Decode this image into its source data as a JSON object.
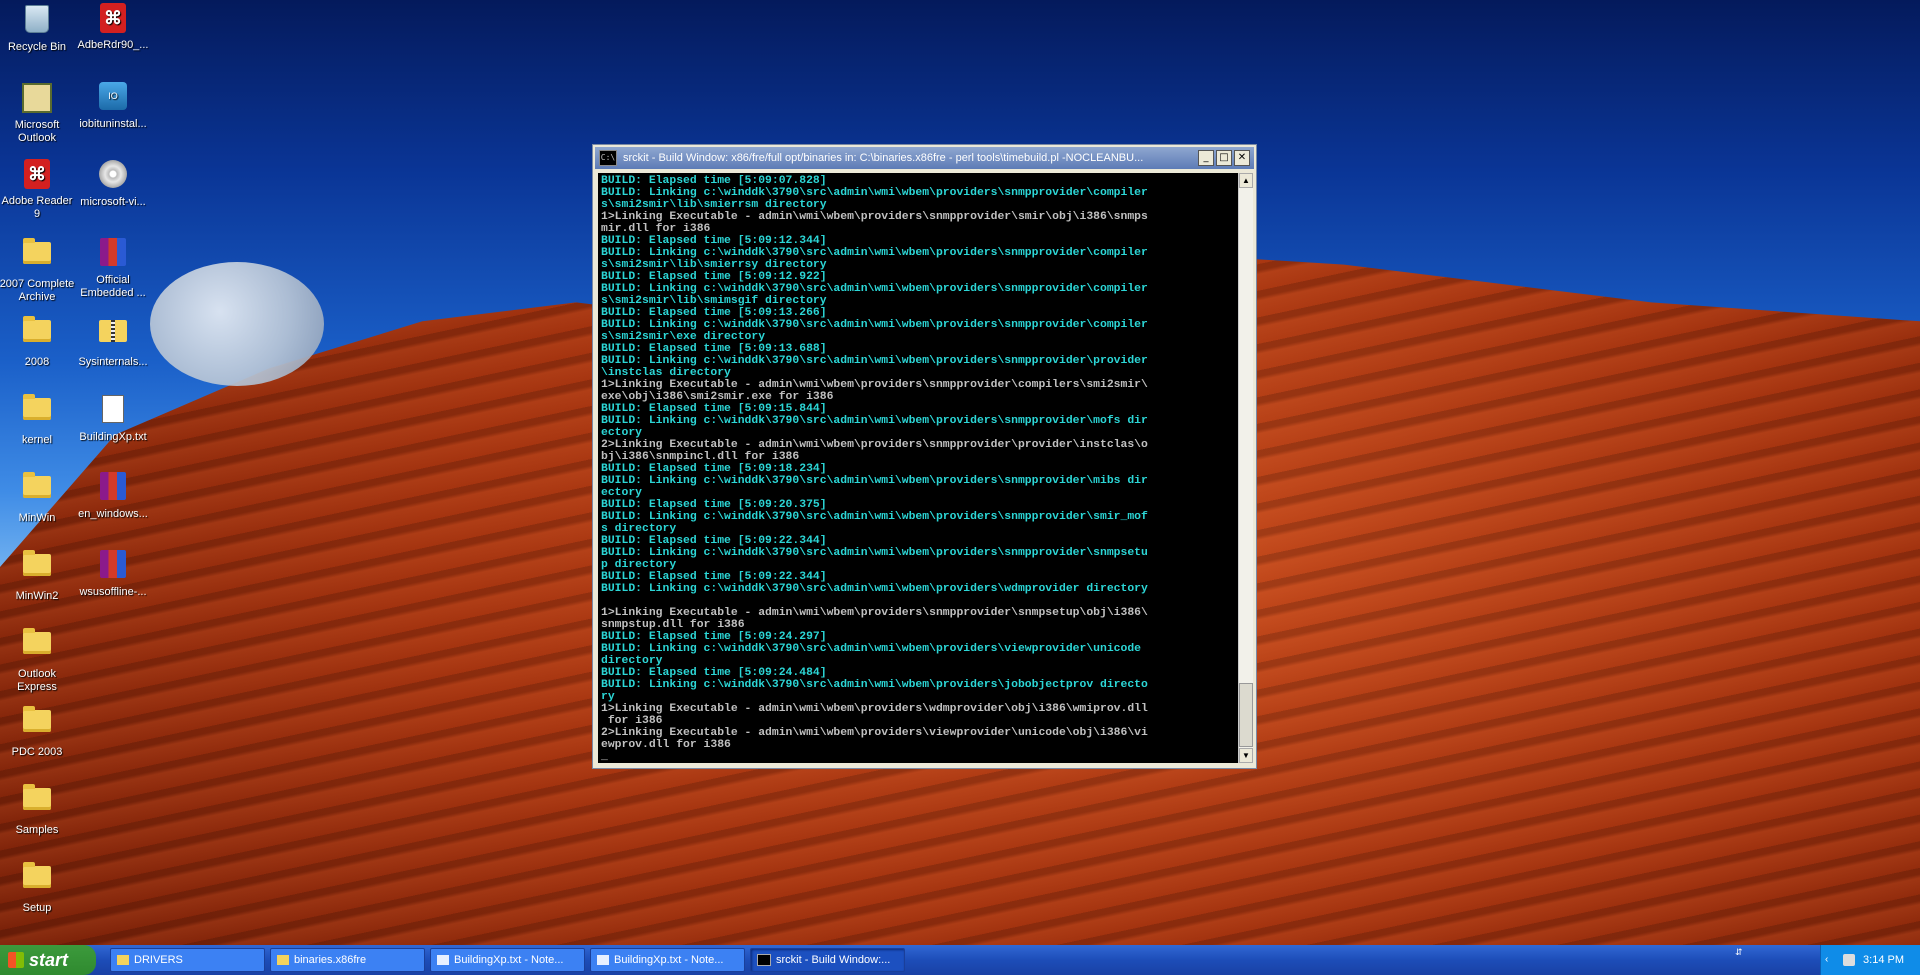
{
  "desktop": {
    "icons": [
      {
        "label": "Recycle Bin",
        "icon": "recycle-bin-icon"
      },
      {
        "label": "AdbeRdr90_...",
        "icon": "pdf-icon"
      },
      {
        "label": "Microsoft Outlook",
        "icon": "outlook-icon"
      },
      {
        "label": "iobituninstal...",
        "icon": "installer-icon"
      },
      {
        "label": "Adobe Reader 9",
        "icon": "pdf-icon"
      },
      {
        "label": "microsoft-vi...",
        "icon": "disc-icon"
      },
      {
        "label": "2007 Complete Archive",
        "icon": "folder-icon"
      },
      {
        "label": "Official Embedded ...",
        "icon": "winrar-icon"
      },
      {
        "label": "2008",
        "icon": "folder-icon"
      },
      {
        "label": "Sysinternals...",
        "icon": "zip-folder-icon"
      },
      {
        "label": "kernel",
        "icon": "folder-icon"
      },
      {
        "label": "BuildingXp.txt",
        "icon": "text-file-icon"
      },
      {
        "label": "MinWin",
        "icon": "folder-icon"
      },
      {
        "label": "en_windows...",
        "icon": "winrar-icon"
      },
      {
        "label": "MinWin2",
        "icon": "folder-icon"
      },
      {
        "label": "wsusoffline-...",
        "icon": "winrar-icon"
      },
      {
        "label": "Outlook Express",
        "icon": "folder-icon"
      },
      {
        "label": "PDC 2003",
        "icon": "folder-icon"
      },
      {
        "label": "Samples",
        "icon": "folder-icon"
      },
      {
        "label": "Setup",
        "icon": "folder-icon"
      }
    ]
  },
  "window": {
    "title": "srckit - Build Window: x86/fre/full opt/binaries in: C:\\binaries.x86fre - perl tools\\timebuild.pl -NOCLEANBU...",
    "minimize": "_",
    "maximize": "□",
    "close": "✕",
    "console_lines": [
      {
        "c": "cyan",
        "t": "BUILD: Elapsed time [5:09:07.828]"
      },
      {
        "c": "cyan",
        "t": "BUILD: Linking c:\\winddk\\3790\\src\\admin\\wmi\\wbem\\providers\\snmpprovider\\compiler"
      },
      {
        "c": "cyan",
        "t": "s\\smi2smir\\lib\\smierrsm directory"
      },
      {
        "c": "grey",
        "t": "1>Linking Executable - admin\\wmi\\wbem\\providers\\snmpprovider\\smir\\obj\\i386\\snmps"
      },
      {
        "c": "grey",
        "t": "mir.dll for i386"
      },
      {
        "c": "cyan",
        "t": "BUILD: Elapsed time [5:09:12.344]"
      },
      {
        "c": "cyan",
        "t": "BUILD: Linking c:\\winddk\\3790\\src\\admin\\wmi\\wbem\\providers\\snmpprovider\\compiler"
      },
      {
        "c": "cyan",
        "t": "s\\smi2smir\\lib\\smierrsy directory"
      },
      {
        "c": "cyan",
        "t": "BUILD: Elapsed time [5:09:12.922]"
      },
      {
        "c": "cyan",
        "t": "BUILD: Linking c:\\winddk\\3790\\src\\admin\\wmi\\wbem\\providers\\snmpprovider\\compiler"
      },
      {
        "c": "cyan",
        "t": "s\\smi2smir\\lib\\smimsgif directory"
      },
      {
        "c": "cyan",
        "t": "BUILD: Elapsed time [5:09:13.266]"
      },
      {
        "c": "cyan",
        "t": "BUILD: Linking c:\\winddk\\3790\\src\\admin\\wmi\\wbem\\providers\\snmpprovider\\compiler"
      },
      {
        "c": "cyan",
        "t": "s\\smi2smir\\exe directory"
      },
      {
        "c": "cyan",
        "t": "BUILD: Elapsed time [5:09:13.688]"
      },
      {
        "c": "cyan",
        "t": "BUILD: Linking c:\\winddk\\3790\\src\\admin\\wmi\\wbem\\providers\\snmpprovider\\provider"
      },
      {
        "c": "cyan",
        "t": "\\instclas directory"
      },
      {
        "c": "grey",
        "t": "1>Linking Executable - admin\\wmi\\wbem\\providers\\snmpprovider\\compilers\\smi2smir\\"
      },
      {
        "c": "grey",
        "t": "exe\\obj\\i386\\smi2smir.exe for i386"
      },
      {
        "c": "cyan",
        "t": "BUILD: Elapsed time [5:09:15.844]"
      },
      {
        "c": "cyan",
        "t": "BUILD: Linking c:\\winddk\\3790\\src\\admin\\wmi\\wbem\\providers\\snmpprovider\\mofs dir"
      },
      {
        "c": "cyan",
        "t": "ectory"
      },
      {
        "c": "grey",
        "t": "2>Linking Executable - admin\\wmi\\wbem\\providers\\snmpprovider\\provider\\instclas\\o"
      },
      {
        "c": "grey",
        "t": "bj\\i386\\snmpincl.dll for i386"
      },
      {
        "c": "cyan",
        "t": "BUILD: Elapsed time [5:09:18.234]"
      },
      {
        "c": "cyan",
        "t": "BUILD: Linking c:\\winddk\\3790\\src\\admin\\wmi\\wbem\\providers\\snmpprovider\\mibs dir"
      },
      {
        "c": "cyan",
        "t": "ectory"
      },
      {
        "c": "cyan",
        "t": "BUILD: Elapsed time [5:09:20.375]"
      },
      {
        "c": "cyan",
        "t": "BUILD: Linking c:\\winddk\\3790\\src\\admin\\wmi\\wbem\\providers\\snmpprovider\\smir_mof"
      },
      {
        "c": "cyan",
        "t": "s directory"
      },
      {
        "c": "cyan",
        "t": "BUILD: Elapsed time [5:09:22.344]"
      },
      {
        "c": "cyan",
        "t": "BUILD: Linking c:\\winddk\\3790\\src\\admin\\wmi\\wbem\\providers\\snmpprovider\\snmpsetu"
      },
      {
        "c": "cyan",
        "t": "p directory"
      },
      {
        "c": "cyan",
        "t": "BUILD: Elapsed time [5:09:22.344]"
      },
      {
        "c": "cyan",
        "t": "BUILD: Linking c:\\winddk\\3790\\src\\admin\\wmi\\wbem\\providers\\wdmprovider directory"
      },
      {
        "c": "grey",
        "t": ""
      },
      {
        "c": "grey",
        "t": "1>Linking Executable - admin\\wmi\\wbem\\providers\\snmpprovider\\snmpsetup\\obj\\i386\\"
      },
      {
        "c": "grey",
        "t": "snmpstup.dll for i386"
      },
      {
        "c": "cyan",
        "t": "BUILD: Elapsed time [5:09:24.297]"
      },
      {
        "c": "cyan",
        "t": "BUILD: Linking c:\\winddk\\3790\\src\\admin\\wmi\\wbem\\providers\\viewprovider\\unicode"
      },
      {
        "c": "cyan",
        "t": "directory"
      },
      {
        "c": "cyan",
        "t": "BUILD: Elapsed time [5:09:24.484]"
      },
      {
        "c": "cyan",
        "t": "BUILD: Linking c:\\winddk\\3790\\src\\admin\\wmi\\wbem\\providers\\jobobjectprov directo"
      },
      {
        "c": "cyan",
        "t": "ry"
      },
      {
        "c": "grey",
        "t": "1>Linking Executable - admin\\wmi\\wbem\\providers\\wdmprovider\\obj\\i386\\wmiprov.dll"
      },
      {
        "c": "grey",
        "t": " for i386"
      },
      {
        "c": "grey",
        "t": "2>Linking Executable - admin\\wmi\\wbem\\providers\\viewprovider\\unicode\\obj\\i386\\vi"
      },
      {
        "c": "grey",
        "t": "ewprov.dll for i386"
      },
      {
        "c": "grey",
        "t": "_"
      }
    ]
  },
  "taskbar": {
    "start_label": "start",
    "tasks": [
      {
        "label": "DRIVERS",
        "icon": "folder-icon",
        "active": false
      },
      {
        "label": "binaries.x86fre",
        "icon": "folder-icon",
        "active": false
      },
      {
        "label": "BuildingXp.txt - Note...",
        "icon": "notepad-icon",
        "active": false
      },
      {
        "label": "BuildingXp.txt - Note...",
        "icon": "notepad-icon",
        "active": false
      },
      {
        "label": "srckit - Build Window:...",
        "icon": "console-icon",
        "active": true
      }
    ],
    "clock": "3:14 PM",
    "colors": {
      "taskbar": "#1d4db8",
      "tray": "#0f8ce8",
      "start": "#2f8a2f"
    }
  }
}
